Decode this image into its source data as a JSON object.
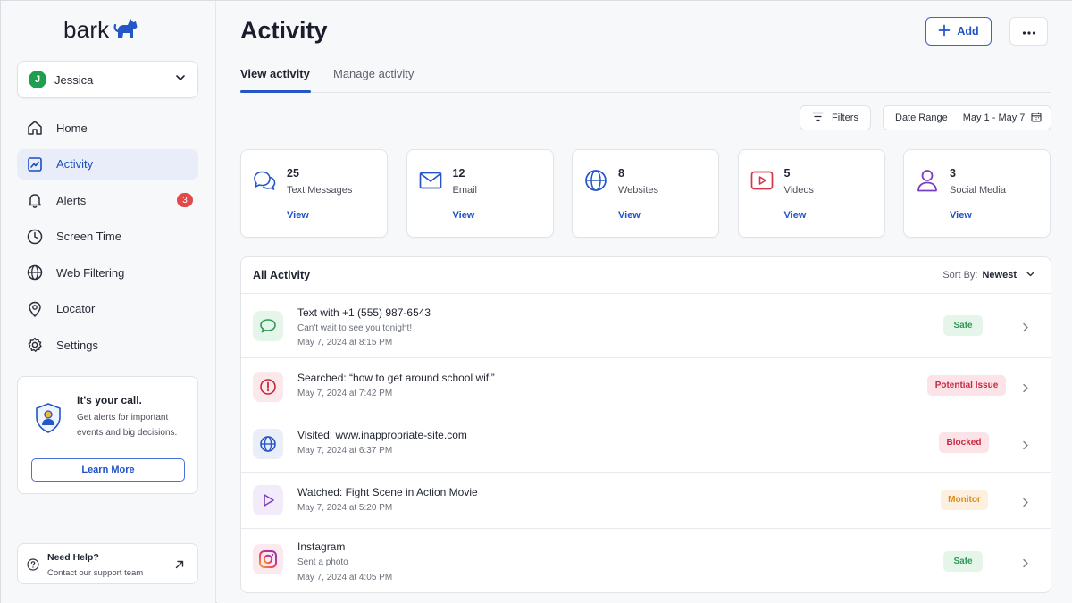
{
  "app": {
    "logo_text": "bark"
  },
  "user": {
    "name": "Jessica",
    "initial": "J"
  },
  "sidebar": {
    "items": [
      {
        "label": "Home",
        "icon": "home-icon"
      },
      {
        "label": "Activity",
        "icon": "activity-icon",
        "active": true
      },
      {
        "label": "Alerts",
        "icon": "bell-icon",
        "badge": "3"
      },
      {
        "label": "Screen Time",
        "icon": "clock-icon"
      },
      {
        "label": "Web Filtering",
        "icon": "globe-icon"
      },
      {
        "label": "Locator",
        "icon": "location-pin-icon"
      },
      {
        "label": "Settings",
        "icon": "gear-icon"
      }
    ],
    "promo": {
      "title": "It's your call.",
      "description": "Get alerts for important events and big decisions.",
      "button_label": "Learn More"
    },
    "help": {
      "title": "Need Help?",
      "subtitle": "Contact our support team"
    }
  },
  "header": {
    "title": "Activity",
    "add_label": "Add",
    "tabs": [
      {
        "label": "View activity",
        "active": true
      },
      {
        "label": "Manage activity"
      }
    ]
  },
  "toolbar": {
    "filters_label": "Filters",
    "date_range_label": "Date Range",
    "date_range_value": "May 1 - May 7"
  },
  "summary_cards": [
    {
      "count": "25",
      "label": "Text Messages",
      "link": "View",
      "icon": "chat-bubbles-icon"
    },
    {
      "count": "12",
      "label": "Email",
      "link": "View",
      "icon": "envelope-icon"
    },
    {
      "count": "8",
      "label": "Websites",
      "link": "View",
      "icon": "globe-icon"
    },
    {
      "count": "5",
      "label": "Videos",
      "link": "View",
      "icon": "video-play-icon"
    },
    {
      "count": "3",
      "label": "Social Media",
      "link": "View",
      "icon": "person-icon"
    }
  ],
  "activity": {
    "title": "All Activity",
    "sort_label": "Sort By:",
    "sort_value": "Newest",
    "rows": [
      {
        "title": "Text with +1 (555) 987-6543",
        "subtitle": "Can't wait to see you tonight!",
        "time": "May 7, 2024 at 8:15 PM",
        "status": "Safe",
        "icon": "chat-bubble-icon"
      },
      {
        "title": "Searched: “how to get around school wifi”",
        "subtitle": "",
        "time": "May 7, 2024 at 7:42 PM",
        "status": "Potential Issue",
        "icon": "alert-circle-icon"
      },
      {
        "title": "Visited: www.inappropriate-site.com",
        "subtitle": "",
        "time": "May 7, 2024 at 6:37 PM",
        "status": "Blocked",
        "icon": "globe-icon"
      },
      {
        "title": "Watched: Fight Scene in Action Movie",
        "subtitle": "",
        "time": "May 7, 2024 at 5:20 PM",
        "status": "Monitor",
        "icon": "play-icon"
      },
      {
        "title": "Instagram",
        "subtitle": "Sent a photo",
        "time": "May 7, 2024 at 4:05 PM",
        "status": "Safe",
        "icon": "instagram-icon"
      }
    ]
  },
  "colors": {
    "accent": "#2152c7",
    "safe_bg": "#e6f5ea",
    "safe_fg": "#2e9a55",
    "issue_bg": "#fbe3e7",
    "issue_fg": "#c8283f",
    "blocked_bg": "#fbe3e7",
    "blocked_fg": "#c8283f",
    "monitor_bg": "#fdf0de",
    "monitor_fg": "#d98a1c"
  }
}
